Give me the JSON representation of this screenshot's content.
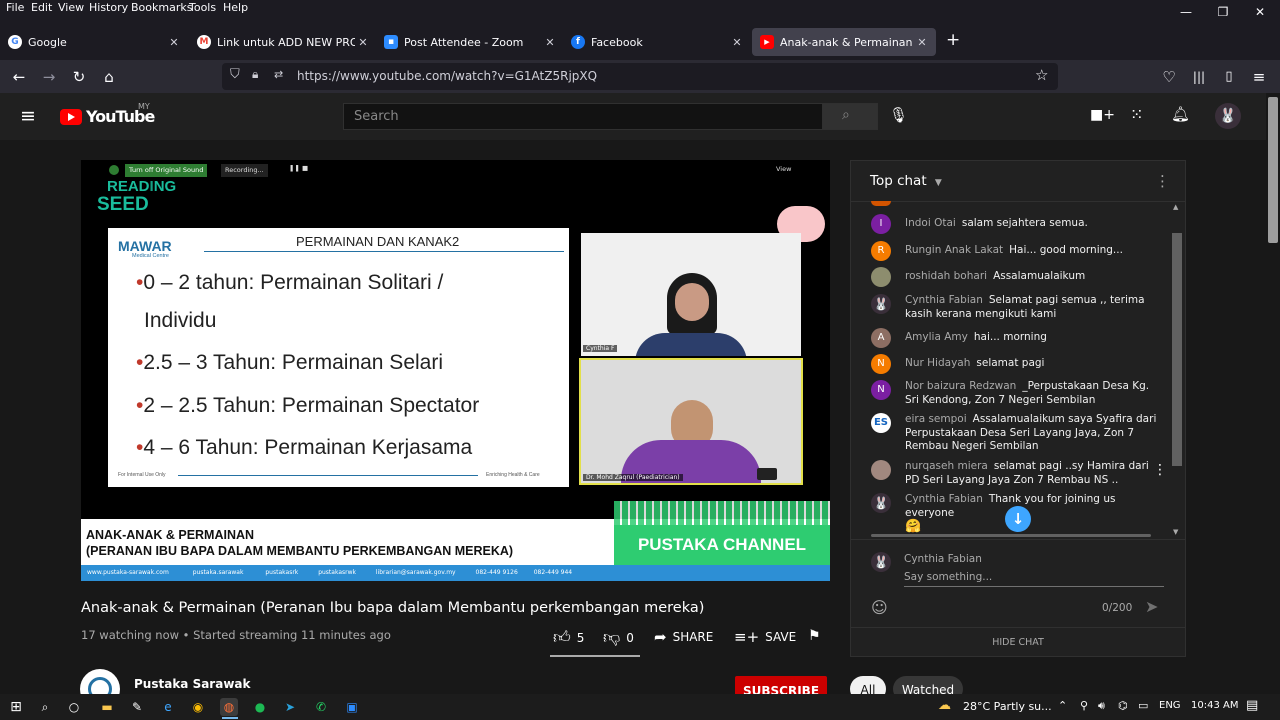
{
  "menu": [
    "File",
    "Edit",
    "View",
    "History",
    "Bookmarks",
    "Tools",
    "Help"
  ],
  "tabs": [
    {
      "label": "Google",
      "icon": "google-icon",
      "color": "#4285f4",
      "glyph": "G"
    },
    {
      "label": "Link untuk ADD NEW PROGRAM",
      "icon": "gmail-icon",
      "color": "#ea4335",
      "glyph": "M"
    },
    {
      "label": "Post Attendee - Zoom",
      "icon": "zoom-icon",
      "color": "#2d8cff",
      "glyph": "▪"
    },
    {
      "label": "Facebook",
      "icon": "facebook-icon",
      "color": "#1877f2",
      "glyph": "f"
    },
    {
      "label": "Anak-anak & Permainan (Perana",
      "icon": "youtube-icon",
      "color": "#ff0000",
      "glyph": "▶"
    }
  ],
  "new_tab": "+",
  "url": "https://www.youtube.com/watch?v=G1AtZ5RjpXQ",
  "yt": {
    "logo": "YouTube",
    "region": "MY",
    "search_placeholder": "Search"
  },
  "video": {
    "top_buttons": {
      "original_sound": "Turn off Original Sound",
      "recording": "Recording...",
      "view": "View"
    },
    "reading_logo": "READING SEED",
    "slide": {
      "logo": "MAWAR",
      "logo_sub": "Medical Centre",
      "title": "PERMAINAN DAN KANAK2",
      "bullets": [
        "0 – 2 tahun: Permainan Solitari /",
        "Individu",
        "2.5 – 3 Tahun: Permainan Selari",
        "2 – 2.5 Tahun: Permainan Spectator",
        "4 – 6 Tahun: Permainan Kerjasama"
      ],
      "footer_left": "For Internal Use Only",
      "footer_right": "Enriching Health & Care"
    },
    "participants": [
      {
        "name": "Cynthia F"
      },
      {
        "name": "Dr. Mohd Zaqrul (Paediatrician)"
      }
    ],
    "caption": {
      "line1": "ANAK-ANAK & PERMAINAN",
      "line2": "(PERANAN IBU BAPA DALAM  MEMBANTU PERKEMBANGAN MEREKA)",
      "channel": "PUSTAKA CHANNEL",
      "contacts": [
        "www.pustaka-sarawak.com",
        "pustaka.sarawak",
        "pustakasrk",
        "pustakasrwk",
        "librarian@sarawak.gov.my",
        "082-449 9126",
        "082-449 944"
      ]
    }
  },
  "info": {
    "title": "Anak-anak & Permainan (Peranan Ibu bapa dalam Membantu perkembangan mereka)",
    "meta": "17 watching now • Started streaming 11 minutes ago",
    "likes": "5",
    "dislikes": "0",
    "share": "SHARE",
    "save": "SAVE"
  },
  "channel": {
    "name": "Pustaka Sarawak",
    "subscribe": "SUBSCRIBE"
  },
  "chips": [
    "All",
    "Watched"
  ],
  "chat": {
    "header": "Top chat",
    "messages": [
      {
        "author": "Indoi Otai",
        "text": "salam sejahtera semua.",
        "initial": "I",
        "color": "#7b1fa2"
      },
      {
        "author": "Rungin Anak Lakat",
        "text": "Hai... good morning...",
        "initial": "R",
        "color": "#f57c00"
      },
      {
        "author": "roshidah bohari",
        "text": "Assalamualaikum",
        "initial": "",
        "color": "#8d8d6e"
      },
      {
        "author": "Cynthia Fabian",
        "text": "Selamat pagi semua ,, terima kasih kerana mengikuti kami",
        "initial": "",
        "color": "#3a2f3a"
      },
      {
        "author": "Amylia Amy",
        "text": "hai... morning",
        "initial": "A",
        "color": "#8d6e63"
      },
      {
        "author": "Nur Hidayah",
        "text": "selamat pagi",
        "initial": "N",
        "color": "#f57c00"
      },
      {
        "author": "Nor baizura Redzwan",
        "text": "_Perpustakaan Desa Kg. Sri Kendong, Zon 7 Negeri Sembilan",
        "initial": "N",
        "color": "#7b1fa2"
      },
      {
        "author": "eira sempoi",
        "text": "Assalamualaikum saya Syafira dari Perpustakaan Desa Seri Layang Jaya, Zon 7 Rembau Negeri Sembilan",
        "initial": "ES",
        "color": "#ffffff"
      },
      {
        "author": "nurqaseh miera",
        "text": "selamat pagi ..sy Hamira dari PD Seri Layang Jaya Zon 7 Rembau NS ..",
        "initial": "",
        "color": "#a1887f"
      },
      {
        "author": "Cynthia Fabian",
        "text": "Thank you for joining us everyone",
        "initial": "",
        "color": "#3a2f3a"
      }
    ],
    "emoji": "🤗",
    "input_author": "Cynthia Fabian",
    "input_placeholder": "Say something...",
    "counter": "0/200",
    "hide": "HIDE CHAT"
  },
  "taskbar": {
    "weather": "28°C  Partly su...",
    "lang": "ENG",
    "time": "10:43 AM"
  }
}
